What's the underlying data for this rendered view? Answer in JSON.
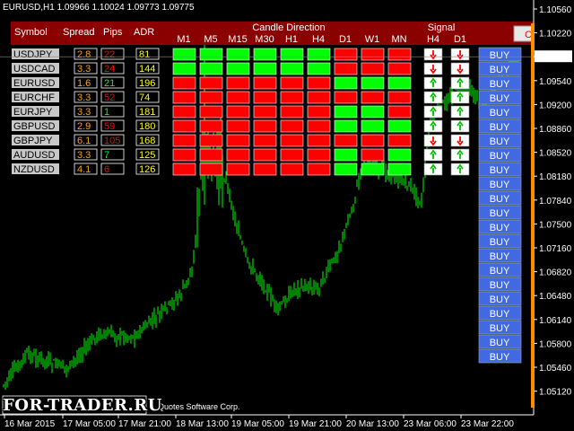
{
  "window": {
    "symbol": "EURUSD,H1",
    "ohlc": [
      "1.09966",
      "1.10024",
      "1.09773",
      "1.09775"
    ],
    "copyright": "Quotes Software Corp.",
    "watermark": "FOR-TRADER.RU"
  },
  "price_axis": {
    "labels": [
      "1.10560",
      "1.10220",
      "1.09775",
      "1.09540",
      "1.09200",
      "1.08860",
      "1.08520",
      "1.08180",
      "1.07840",
      "1.07500",
      "1.07160",
      "1.06820",
      "1.06480",
      "1.06140",
      "1.05800",
      "1.05460",
      "1.05120"
    ],
    "current_price": "1.09775"
  },
  "time_axis": {
    "labels": [
      "16 Mar 2015",
      "17 Mar 05:00",
      "17 Mar 21:00",
      "18 Mar 13:00",
      "19 Mar 05:00",
      "19 Mar 21:00",
      "20 Mar 13:00",
      "23 Mar 06:00",
      "23 Mar 22:00"
    ]
  },
  "dashboard": {
    "section_candle": "Candle Direction",
    "section_signal": "Signal",
    "col_symbol": "Symbol",
    "col_spread": "Spread",
    "col_pips": "Pips",
    "col_adr": "ADR",
    "timeframes": [
      "M1",
      "M5",
      "M15",
      "M30",
      "H1",
      "H4",
      "D1",
      "W1",
      "MN"
    ],
    "signal_timeframes": [
      "H4",
      "D1"
    ],
    "close_button": "Cl",
    "buy_label": "BUY",
    "buy_count": 22,
    "colors": {
      "up": "#00ff00",
      "down": "#ff0000",
      "buy": "#4169e1",
      "header": "#8b0000"
    },
    "rows": [
      {
        "symbol": "USDJPY",
        "spread": "2.8",
        "pips": "22",
        "pips_dir": "down",
        "adr": "81",
        "candles": [
          "up",
          "up",
          "up",
          "up",
          "up",
          "up",
          "down",
          "down",
          "down"
        ],
        "signals": [
          "down",
          "down"
        ]
      },
      {
        "symbol": "USDCAD",
        "spread": "3.3",
        "pips": "24",
        "pips_dir": "down",
        "adr": "144",
        "candles": [
          "up",
          "up",
          "up",
          "up",
          "up",
          "up",
          "down",
          "down",
          "down"
        ],
        "signals": [
          "down",
          "down"
        ]
      },
      {
        "symbol": "EURUSD",
        "spread": "1.6",
        "pips": "21",
        "pips_dir": "up",
        "adr": "196",
        "candles": [
          "down",
          "down",
          "down",
          "down",
          "down",
          "down",
          "up",
          "up",
          "up"
        ],
        "signals": [
          "up",
          "up"
        ]
      },
      {
        "symbol": "EURCHF",
        "spread": "3.3",
        "pips": "52",
        "pips_dir": "down",
        "adr": "74",
        "candles": [
          "down",
          "down",
          "down",
          "down",
          "down",
          "down",
          "down",
          "down",
          "down"
        ],
        "signals": [
          "up",
          "up"
        ]
      },
      {
        "symbol": "EURJPY",
        "spread": "3.3",
        "pips": "1",
        "pips_dir": "up",
        "adr": "181",
        "candles": [
          "down",
          "down",
          "down",
          "down",
          "down",
          "down",
          "up",
          "up",
          "down"
        ],
        "signals": [
          "up",
          "up"
        ]
      },
      {
        "symbol": "GBPUSD",
        "spread": "2.9",
        "pips": "59",
        "pips_dir": "down",
        "adr": "180",
        "candles": [
          "down",
          "down",
          "down",
          "down",
          "down",
          "down",
          "up",
          "up",
          "up"
        ],
        "signals": [
          "up",
          "up"
        ]
      },
      {
        "symbol": "GBPJPY",
        "spread": "6.1",
        "pips": "105",
        "pips_dir": "down",
        "adr": "168",
        "candles": [
          "down",
          "down",
          "down",
          "down",
          "down",
          "down",
          "down",
          "down",
          "down"
        ],
        "signals": [
          "down",
          "down"
        ]
      },
      {
        "symbol": "AUDUSD",
        "spread": "3.3",
        "pips": "7",
        "pips_dir": "up",
        "adr": "125",
        "candles": [
          "down",
          "down",
          "down",
          "down",
          "down",
          "down",
          "up",
          "down",
          "up"
        ],
        "signals": [
          "up",
          "up"
        ]
      },
      {
        "symbol": "NZDUSD",
        "spread": "4.1",
        "pips": "6",
        "pips_dir": "down",
        "adr": "126",
        "candles": [
          "down",
          "down",
          "down",
          "down",
          "down",
          "down",
          "up",
          "up",
          "up"
        ],
        "signals": [
          "up",
          "up"
        ]
      }
    ]
  }
}
